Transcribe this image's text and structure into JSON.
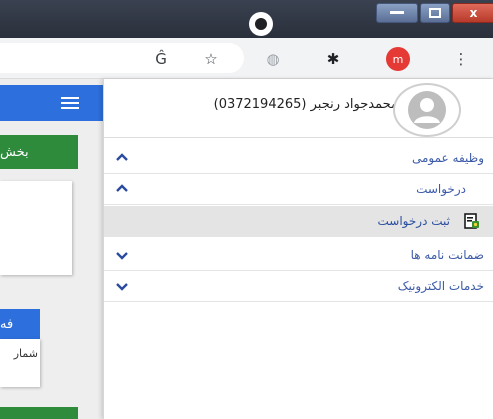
{
  "window": {
    "close_glyph": "x"
  },
  "toolbar": {
    "icons": [
      "translate-icon",
      "star-icon",
      "globe-icon",
      "puzzle-icon",
      "profile-avatar",
      "more-vert-icon"
    ],
    "translate_glyph": "Ĝ",
    "star_glyph": "☆",
    "globe_glyph": "◍",
    "puzzle_glyph": "✱",
    "avatar_letter": "m",
    "more_glyph": "⋮"
  },
  "page": {
    "green_tab_label": "بخش",
    "blue_tab_label": "فه",
    "small_card_text": "شمار"
  },
  "drawer": {
    "user_name": "محمدجواد رنجبر (0372194265)",
    "menu": [
      {
        "label": "وظیفه عمومی",
        "expanded": true
      },
      {
        "label": "درخواست",
        "expanded": true
      },
      {
        "label": "ثبت درخواست",
        "selected": true
      },
      {
        "label": "ضمانت نامه ها",
        "expanded": false
      },
      {
        "label": "خدمات الکترونیک",
        "expanded": false
      }
    ]
  },
  "colors": {
    "accent_blue": "#2d6fdc",
    "accent_green": "#2e8b3c",
    "menu_text": "#3b5aa8"
  }
}
